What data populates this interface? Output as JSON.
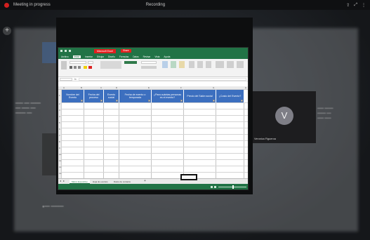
{
  "top_bar": {
    "left_text": "Meeting in progress",
    "center_text": "Recording",
    "right_icons": [
      "share-icon",
      "expand-icon",
      "more-icon"
    ]
  },
  "excel": {
    "title": "Microsoft Excel",
    "title_button": "Share",
    "menu": [
      "Archivo",
      "Inicio",
      "Insertar",
      "Dibujar",
      "Diseño",
      "Fórmulas",
      "Datos",
      "Revisar",
      "Vista",
      "Ayuda"
    ],
    "active_menu_index": 1,
    "formula_bar_label": "fx",
    "columns": [
      "A",
      "B",
      "C",
      "D",
      "E",
      "F",
      "G",
      "H"
    ],
    "table_headers": [
      "Nombre del Evento",
      "Fecha del proceso",
      "Evento social",
      "Fecha de evento o temporada",
      "¿Para cuántas personas es el evento?",
      "Precio del Salón social",
      "¿Costo del Evento?"
    ],
    "row_numbers": [
      "1",
      "2",
      "3",
      "4",
      "5",
      "6",
      "7",
      "8",
      "9",
      "10",
      "11",
      "12",
      "13"
    ],
    "sheets": [
      "Marco Expositivo",
      "Hoja de eventos",
      "Datos de contacto"
    ],
    "active_sheet_index": 0,
    "add_sheet": "+"
  },
  "participant": {
    "initial": "V",
    "name": "Veronica Figueroa"
  },
  "colors": {
    "excel_green": "#217346",
    "header_blue": "#3c6fbf",
    "record_red": "#d21f1f"
  }
}
